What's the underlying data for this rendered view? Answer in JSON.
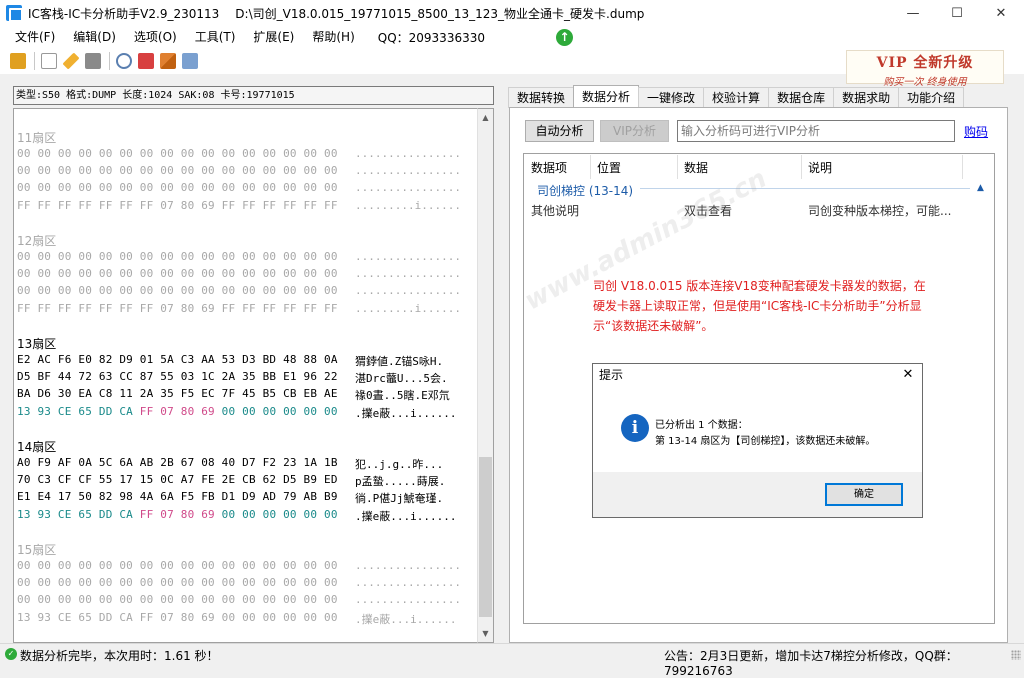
{
  "window": {
    "app_title": "IC客栈-IC卡分析助手V2.9_230113",
    "file_path": "D:\\司创_V18.0.015_19771015_8500_13_123_物业全通卡_硬发卡.dump",
    "minimize_glyph": "—",
    "maximize_glyph": "☐",
    "close_glyph": "✕"
  },
  "menu": {
    "items": [
      "文件(F)",
      "编辑(D)",
      "选项(O)",
      "工具(T)",
      "扩展(E)",
      "帮助(H)"
    ],
    "qq": "QQ：2093336330"
  },
  "toolbar": {
    "icons": [
      "book-icon",
      "new-file-icon",
      "pencil-icon",
      "save-icon",
      "magnifier-icon",
      "calendar-icon",
      "chart-icon",
      "settings-icon"
    ]
  },
  "vip_banner": {
    "title": "VIP 全新升级",
    "subtitle": "购买一次    终身使用"
  },
  "info_bar": "类型:S50 格式:DUMP 长度:1024 SAK:08 卡号:19771015",
  "hex": {
    "sectors": [
      {
        "label": "11扇区",
        "style": "gray",
        "rows": [
          {
            "hex": "00 00 00 00 00 00 00 00 00 00 00 00 00 00 00 00",
            "ascii": "................"
          },
          {
            "hex": "00 00 00 00 00 00 00 00 00 00 00 00 00 00 00 00",
            "ascii": "................"
          },
          {
            "hex": "00 00 00 00 00 00 00 00 00 00 00 00 00 00 00 00",
            "ascii": "................"
          },
          {
            "hex": "FF FF FF FF FF FF FF 07 80 69 FF FF FF FF FF FF",
            "ascii": ".........i......"
          }
        ]
      },
      {
        "label": "12扇区",
        "style": "gray",
        "rows": [
          {
            "hex": "00 00 00 00 00 00 00 00 00 00 00 00 00 00 00 00",
            "ascii": "................"
          },
          {
            "hex": "00 00 00 00 00 00 00 00 00 00 00 00 00 00 00 00",
            "ascii": "................"
          },
          {
            "hex": "00 00 00 00 00 00 00 00 00 00 00 00 00 00 00 00",
            "ascii": "................"
          },
          {
            "hex": "FF FF FF FF FF FF FF 07 80 69 FF FF FF FF FF FF",
            "ascii": ".........i......"
          }
        ]
      },
      {
        "label": "13扇区",
        "style": "black",
        "rows": [
          {
            "hex": "E2 AC F6 E0 82 D9 01 5A C3 AA 53 D3 BD 48 88 0A",
            "ascii": "猬鋍値.Z锚S咏H."
          },
          {
            "hex": "D5 BF 44 72 63 CC 87 55 03 1C 2A 35 BB E1 96 22",
            "ascii": "湛Drc虌U...5会."
          },
          {
            "hex": "BA D6 30 EA C8 11 2A 35 F5 EC 7F 45 B5 CB EB AE",
            "ascii": "禒0晝..5瞎.E邓氘"
          },
          {
            "hex": "13 93 CE 65 DD CA FF 07 80 69 00 00 00 00 00 00",
            "ascii": ".擈e蔽...i......",
            "colored": true
          }
        ]
      },
      {
        "label": "14扇区",
        "style": "black",
        "rows": [
          {
            "hex": "A0 F9 AF 0A 5C 6A AB 2B 67 08 40 D7 F2 23 1A 1B",
            "ascii": "犯..j.g..昨..."
          },
          {
            "hex": "70 C3 CF CF 55 17 15 0C A7 FE 2E CB 62 D5 B9 ED",
            "ascii": "p孟蟄.....蒔展."
          },
          {
            "hex": "E1 E4 17 50 82 98 4A 6A F5 FB D1 D9 AD 79 AB B9",
            "ascii": "徜.P偡Jj鯱奄瑾."
          },
          {
            "hex": "13 93 CE 65 DD CA FF 07 80 69 00 00 00 00 00 00",
            "ascii": ".擈e蔽...i......",
            "colored": true
          }
        ]
      },
      {
        "label": "15扇区",
        "style": "gray",
        "rows": [
          {
            "hex": "00 00 00 00 00 00 00 00 00 00 00 00 00 00 00 00",
            "ascii": "................"
          },
          {
            "hex": "00 00 00 00 00 00 00 00 00 00 00 00 00 00 00 00",
            "ascii": "................"
          },
          {
            "hex": "00 00 00 00 00 00 00 00 00 00 00 00 00 00 00 00",
            "ascii": "................"
          },
          {
            "hex": "13 93 CE 65 DD CA FF 07 80 69 00 00 00 00 00 00",
            "ascii": ".擈e蔽...i......"
          }
        ]
      }
    ]
  },
  "tabs": [
    "数据转换",
    "数据分析",
    "一键修改",
    "校验计算",
    "数据仓库",
    "数据求助",
    "功能介绍"
  ],
  "active_tab": 1,
  "analysis": {
    "auto_button": "自动分析",
    "vip_button": "VIP分析",
    "vip_input_placeholder": "输入分析码可进行VIP分析",
    "buy_link": "购码",
    "columns": [
      "数据项",
      "位置",
      "数据",
      "说明"
    ],
    "group": "司创梯控  (13-14)",
    "row": {
      "item": "其他说明",
      "position": "",
      "data": "双击查看",
      "desc": "司创变种版本梯控，可能..."
    }
  },
  "red_note": "司创 V18.0.015 版本连接V18变种配套硬发卡器发的数据，在硬发卡器上读取正常，但是使用“IC客栈-IC卡分析助手”分析显示“该数据还未破解”。",
  "watermark": "www.admin365.cn",
  "dialog": {
    "title": "提示",
    "close": "✕",
    "line1": "已分析出 1 个数据：",
    "line2": "第 13-14 扇区为【司创梯控】，该数据还未破解。",
    "ok": "确定"
  },
  "status": {
    "left": "数据分析完毕，本次用时：1.61 秒！",
    "right": "公告：2月3日更新，增加卡达7梯控分析修改，QQ群：799216763"
  },
  "colors": {
    "accent_blue": "#1565c0",
    "group_blue": "#1c5ba8",
    "note_red": "#e02020",
    "teal": "#1a8a8a",
    "pink": "#d04a8a",
    "ok_green": "#2eaa3a"
  }
}
